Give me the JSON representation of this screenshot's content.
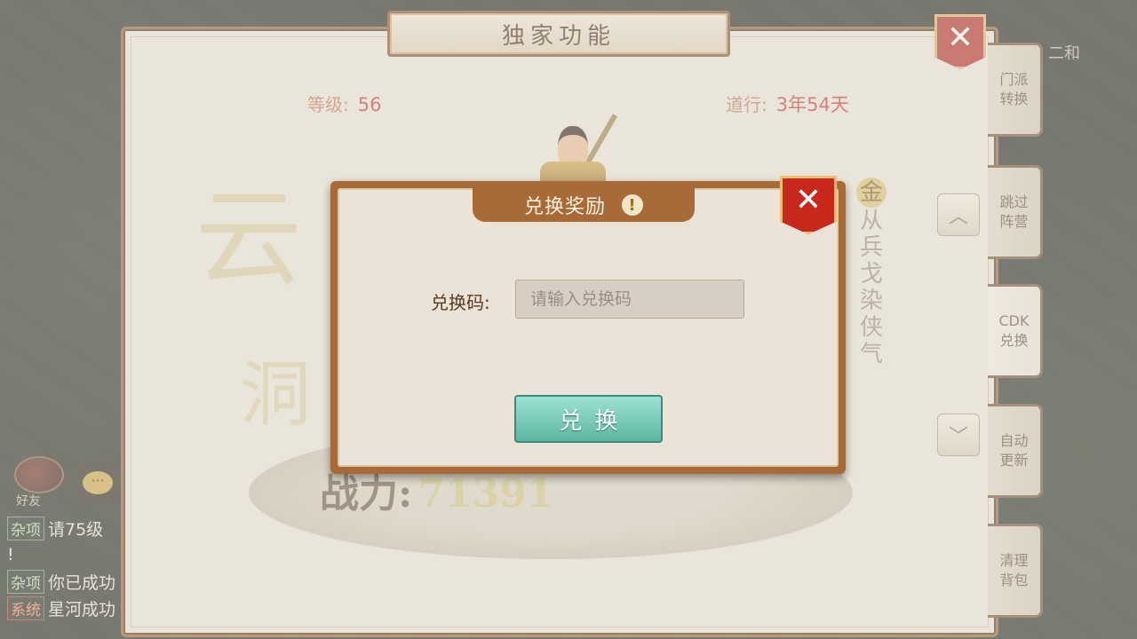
{
  "hud": {
    "friends_label": "好友",
    "chat_icon": "chat-bubble-icon",
    "chat_lines": [
      {
        "tag": "杂项",
        "text": "请75级"
      },
      {
        "tag": "",
        "text": "!"
      },
      {
        "tag": "杂项",
        "text": "你已成功"
      },
      {
        "tag": "系统",
        "text": "星河成功"
      }
    ],
    "top_right_name": "二和"
  },
  "panel": {
    "title": "独家功能",
    "level_label": "等级:",
    "level_value": "56",
    "dao_label": "道行:",
    "dao_value": "3年54天",
    "calligraphy": "云",
    "calligraphy2": "洞",
    "power_label": "战力:",
    "power_value": "71391",
    "vertical_title_badge": "金",
    "vertical_title": "从兵戈染侠气",
    "arrow_up": "up-arrow",
    "arrow_down": "down-arrow"
  },
  "tabs": [
    {
      "label": "门派转换",
      "active": false
    },
    {
      "label": "跳过阵营",
      "active": false
    },
    {
      "label": "CDK兑换",
      "active": true
    },
    {
      "label": "自动更新",
      "active": false
    },
    {
      "label": "清理背包",
      "active": false
    }
  ],
  "dialog": {
    "title": "兑换奖励",
    "code_label": "兑换码:",
    "code_value": "",
    "code_placeholder": "请输入兑换码",
    "redeem_label": "兑换"
  },
  "colors": {
    "panel_border": "#8a5a30",
    "close_red": "#c8281c",
    "redeem_teal": "#5cb6a2",
    "stat_red": "#c0302a"
  }
}
